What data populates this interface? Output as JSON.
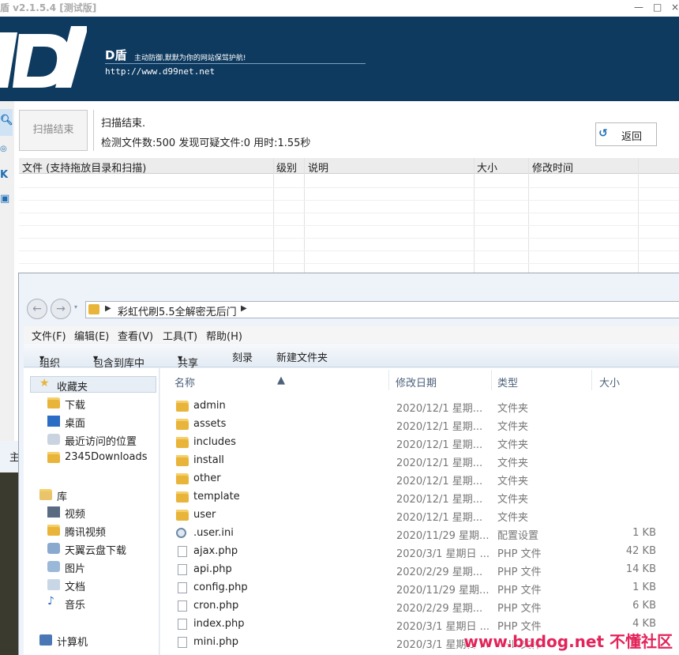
{
  "app": {
    "title": "盾 v2.1.5.4 [测试版]",
    "minimize": "—",
    "maximize": "□",
    "close": "×",
    "brand": "D盾",
    "slogan": "主动防御,默默为你的网站保驾护航!",
    "url": "http://www.d99net.net"
  },
  "scan": {
    "button_label": "扫描结束",
    "status_line1": "扫描结束.",
    "status_line2": "检测文件数:500 发现可疑文件:0 用时:1.55秒",
    "back_label": "返回",
    "columns": [
      "文件 (支持拖放目录和扫描)",
      "级别",
      "说明",
      "大小",
      "修改时间"
    ]
  },
  "explorer": {
    "path": "彩虹代刷5.5全解密无后门",
    "menu": [
      "文件(F)",
      "编辑(E)",
      "查看(V)",
      "工具(T)",
      "帮助(H)"
    ],
    "toolbar": [
      "组织",
      "包含到库中",
      "共享",
      "刻录",
      "新建文件夹"
    ],
    "nav": {
      "favorites": "收藏夹",
      "fav_items": [
        "下载",
        "桌面",
        "最近访问的位置",
        "2345Downloads"
      ],
      "library": "库",
      "lib_items": [
        "视频",
        "腾讯视频",
        "天翼云盘下载",
        "图片",
        "文档",
        "音乐"
      ],
      "computer": "计算机"
    },
    "columns": {
      "name": "名称",
      "date": "修改日期",
      "type": "类型",
      "size": "大小"
    },
    "files": [
      {
        "name": "admin",
        "date": "2020/12/1 星期...",
        "type": "文件夹",
        "size": "",
        "icon": "folder"
      },
      {
        "name": "assets",
        "date": "2020/12/1 星期...",
        "type": "文件夹",
        "size": "",
        "icon": "folder"
      },
      {
        "name": "includes",
        "date": "2020/12/1 星期...",
        "type": "文件夹",
        "size": "",
        "icon": "folder"
      },
      {
        "name": "install",
        "date": "2020/12/1 星期...",
        "type": "文件夹",
        "size": "",
        "icon": "folder"
      },
      {
        "name": "other",
        "date": "2020/12/1 星期...",
        "type": "文件夹",
        "size": "",
        "icon": "folder"
      },
      {
        "name": "template",
        "date": "2020/12/1 星期...",
        "type": "文件夹",
        "size": "",
        "icon": "folder"
      },
      {
        "name": "user",
        "date": "2020/12/1 星期...",
        "type": "文件夹",
        "size": "",
        "icon": "folder"
      },
      {
        "name": ".user.ini",
        "date": "2020/11/29 星期...",
        "type": "配置设置",
        "size": "1 KB",
        "icon": "gear"
      },
      {
        "name": "ajax.php",
        "date": "2020/3/1 星期日 ...",
        "type": "PHP 文件",
        "size": "42 KB",
        "icon": "file"
      },
      {
        "name": "api.php",
        "date": "2020/2/29 星期...",
        "type": "PHP 文件",
        "size": "14 KB",
        "icon": "file"
      },
      {
        "name": "config.php",
        "date": "2020/11/29 星期...",
        "type": "PHP 文件",
        "size": "1 KB",
        "icon": "file"
      },
      {
        "name": "cron.php",
        "date": "2020/2/29 星期...",
        "type": "PHP 文件",
        "size": "6 KB",
        "icon": "file"
      },
      {
        "name": "index.php",
        "date": "2020/3/1 星期日 ...",
        "type": "PHP 文件",
        "size": "4 KB",
        "icon": "file"
      },
      {
        "name": "mini.php",
        "date": "2020/3/1 星期日 ...",
        "type": "PHP 文件",
        "size": "",
        "icon": "file"
      }
    ]
  },
  "behind_window_text": "主",
  "watermark": "www.budog.net 不懂社区",
  "colors": {
    "banner": "#0e3a5f",
    "accent": "#1e6fb5",
    "folder": "#e8b43a",
    "watermark": "#e3245a"
  }
}
